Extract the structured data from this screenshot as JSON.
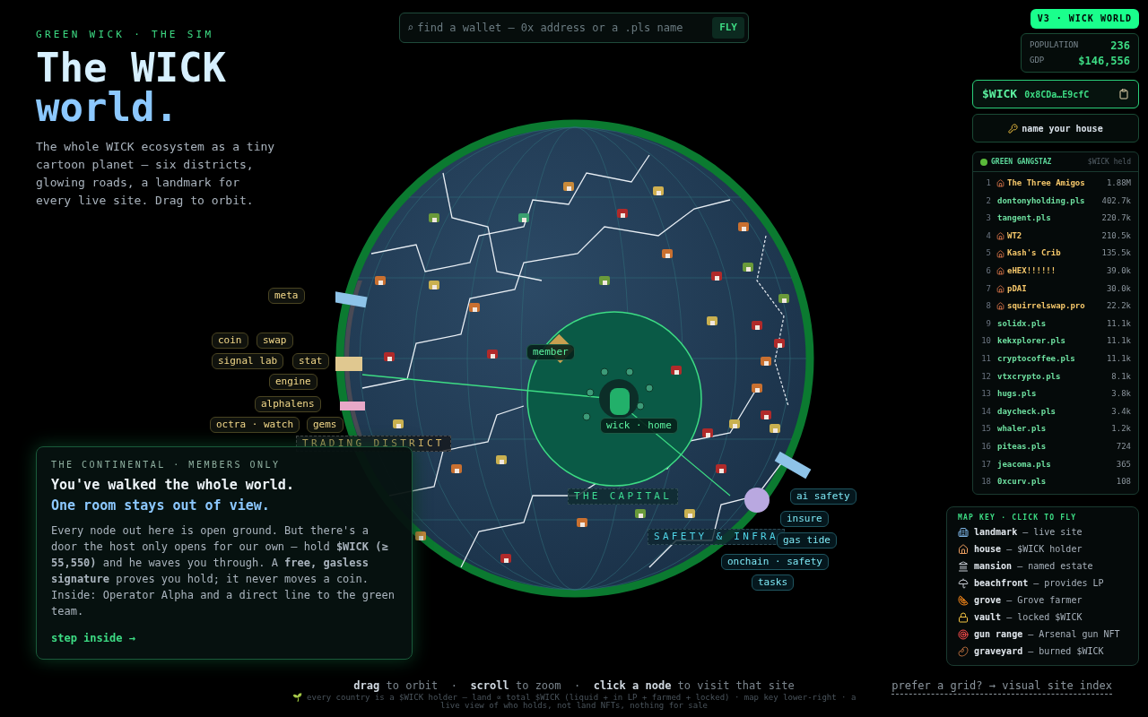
{
  "header": {
    "eyebrow": "GREEN WICK · THE SIM",
    "title_lines": [
      "The WICK",
      "world."
    ],
    "description": "The whole WICK ecosystem as a tiny cartoon planet — six districts, glowing roads, a landmark for every live site. Drag to orbit."
  },
  "search": {
    "placeholder": "find a wallet — 0x address or a .pls name",
    "icon": "⌕",
    "button": "FLY"
  },
  "version_badge": "V3 · WICK WORLD",
  "stats": [
    {
      "label": "POPULATION",
      "value": "236"
    },
    {
      "label": "GDP",
      "value": "$146,556"
    }
  ],
  "token": {
    "symbol": "$WICK",
    "address": "0x8CDa…E9cfC"
  },
  "name_house_button": "name your house",
  "leaderboard": {
    "title": "GREEN GANGSTAZ",
    "column": "$WICK held",
    "rows": [
      {
        "rank": "1",
        "kind": "house",
        "name": "The Three Amigos",
        "value": "1.88M"
      },
      {
        "rank": "2",
        "kind": "site",
        "name": "dontonyholding.pls",
        "value": "402.7k"
      },
      {
        "rank": "3",
        "kind": "site",
        "name": "tangent.pls",
        "value": "220.7k"
      },
      {
        "rank": "4",
        "kind": "house",
        "name": "WT2",
        "value": "210.5k"
      },
      {
        "rank": "5",
        "kind": "house",
        "name": "Kash's Crib",
        "value": "135.5k"
      },
      {
        "rank": "6",
        "kind": "house",
        "name": "eHEX!!!!!!",
        "value": "39.0k"
      },
      {
        "rank": "7",
        "kind": "house",
        "name": "pDAI",
        "value": "30.0k"
      },
      {
        "rank": "8",
        "kind": "house",
        "name": "squirrelswap.pro",
        "value": "22.2k"
      },
      {
        "rank": "9",
        "kind": "site",
        "name": "solidx.pls",
        "value": "11.1k"
      },
      {
        "rank": "10",
        "kind": "site",
        "name": "kekxplorer.pls",
        "value": "11.1k"
      },
      {
        "rank": "11",
        "kind": "site",
        "name": "cryptocoffee.pls",
        "value": "11.1k"
      },
      {
        "rank": "12",
        "kind": "site",
        "name": "vtxcrypto.pls",
        "value": "8.1k"
      },
      {
        "rank": "13",
        "kind": "site",
        "name": "hugs.pls",
        "value": "3.8k"
      },
      {
        "rank": "14",
        "kind": "site",
        "name": "daycheck.pls",
        "value": "3.4k"
      },
      {
        "rank": "15",
        "kind": "site",
        "name": "whaler.pls",
        "value": "1.2k"
      },
      {
        "rank": "16",
        "kind": "site",
        "name": "piteas.pls",
        "value": "724"
      },
      {
        "rank": "17",
        "kind": "site",
        "name": "jeacoma.pls",
        "value": "365"
      },
      {
        "rank": "18",
        "kind": "site",
        "name": "0xcurv.pls",
        "value": "108"
      }
    ]
  },
  "map_key": {
    "title": "MAP KEY · CLICK TO FLY",
    "items": [
      {
        "kind": "landmark",
        "name": "landmark",
        "desc": "— live site"
      },
      {
        "kind": "house",
        "name": "house",
        "desc": "— $WICK holder"
      },
      {
        "kind": "mansion",
        "name": "mansion",
        "desc": "— named estate"
      },
      {
        "kind": "beachfront",
        "name": "beachfront",
        "desc": "— provides LP"
      },
      {
        "kind": "grove",
        "name": "grove",
        "desc": "— Grove farmer"
      },
      {
        "kind": "vault",
        "name": "vault",
        "desc": "— locked $WICK"
      },
      {
        "kind": "gun_range",
        "name": "gun range",
        "desc": "— Arsenal gun NFT"
      },
      {
        "kind": "graveyard",
        "name": "graveyard",
        "desc": "— burned $WICK"
      }
    ]
  },
  "globe_labels": [
    {
      "kind": "site",
      "text": "meta"
    },
    {
      "kind": "site",
      "text": "coin"
    },
    {
      "kind": "site",
      "text": "swap"
    },
    {
      "kind": "site",
      "text": "signal lab"
    },
    {
      "kind": "site",
      "text": "stat"
    },
    {
      "kind": "site",
      "text": "engine"
    },
    {
      "kind": "site",
      "text": "alphalens"
    },
    {
      "kind": "site",
      "text": "octra · watch"
    },
    {
      "kind": "site",
      "text": "gems"
    },
    {
      "kind": "district",
      "text": "TRADING DISTRICT"
    },
    {
      "kind": "capital",
      "text": "member"
    },
    {
      "kind": "capital",
      "text": "wick · home"
    },
    {
      "kind": "capital_district",
      "text": "THE CAPITAL"
    },
    {
      "kind": "infra",
      "text": "ai safety"
    },
    {
      "kind": "infra_district",
      "text": "SAFETY & INFRA"
    },
    {
      "kind": "infra",
      "text": "insure"
    },
    {
      "kind": "infra",
      "text": "gas tide"
    },
    {
      "kind": "infra",
      "text": "onchain · safety"
    },
    {
      "kind": "infra",
      "text": "tasks"
    }
  ],
  "members_card": {
    "eyebrow": "THE CONTINENTAL · MEMBERS ONLY",
    "headline": "You've walked the whole world.",
    "subheadline": "One room stays out of view.",
    "body": "Every node out here is open ground. But there's a door the host only opens for our own — hold **$WICK (≥ 55,550)** and he waves you through. A **free, gasless signature** proves you hold; it never moves a coin. Inside: Operator Alpha and a direct line to the green team.",
    "link": "step inside →"
  },
  "footer": {
    "hint": "**drag** to orbit  ·  **scroll** to zoom  ·  **click a node** to visit that site",
    "note": "🌱 every country is a $WICK holder — land ∝ total $WICK (liquid + in LP + farmed + locked) · map key lower-right · a live view of who holds, not land NFTs, nothing for sale",
    "grid_link": "prefer a grid? → visual site index"
  }
}
